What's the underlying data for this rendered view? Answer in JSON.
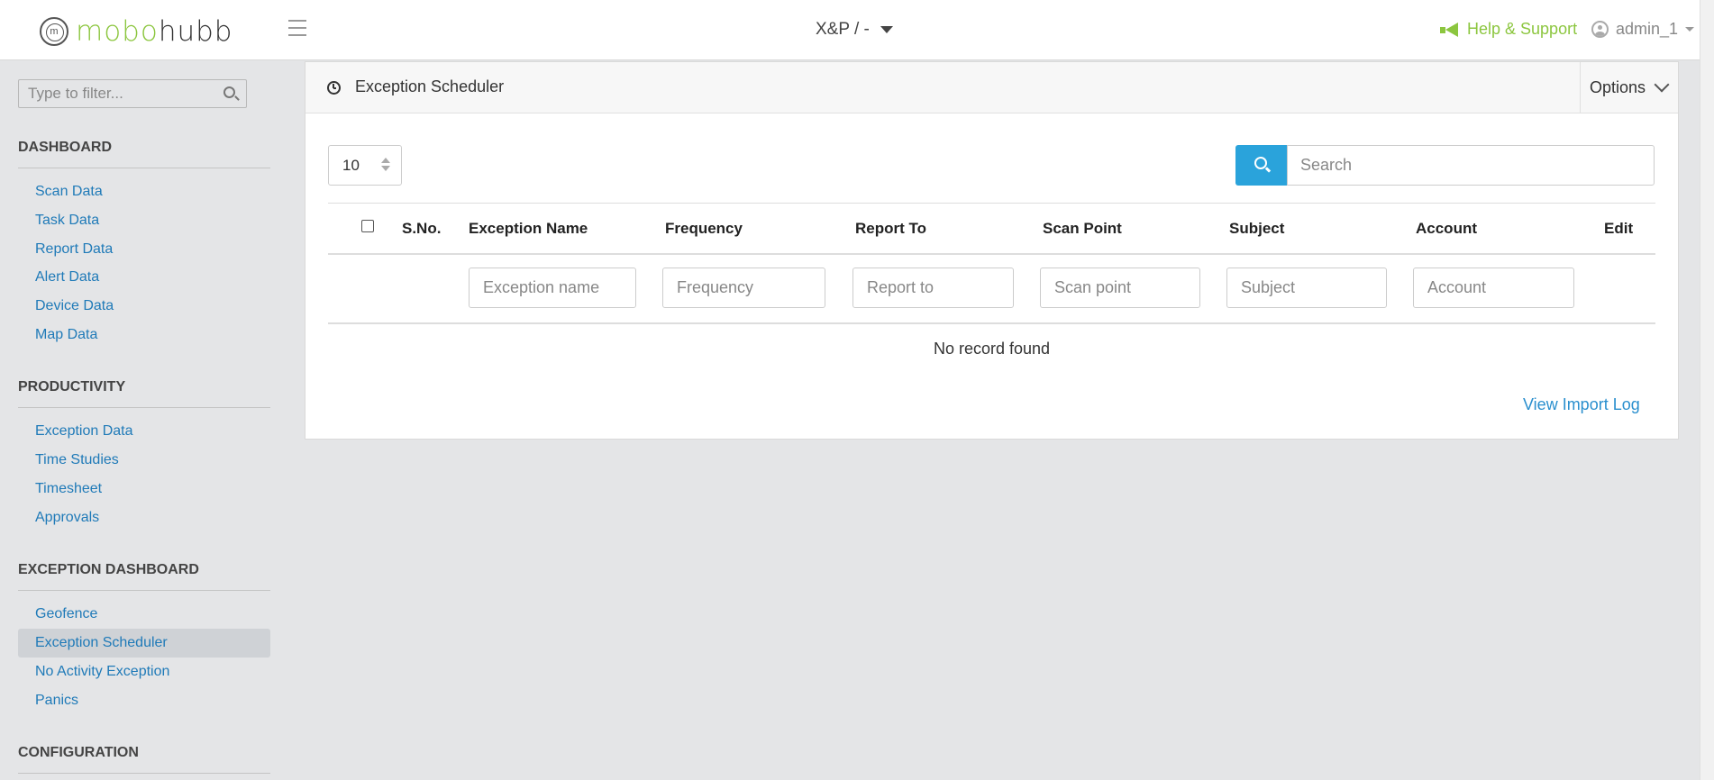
{
  "brand": {
    "logo_mark": "m",
    "name_part1": "mobo",
    "name_part2": "hubb",
    "accent": "#8cc63f"
  },
  "topbar": {
    "project": "X&P / -",
    "help": "Help & Support",
    "user": "admin_1"
  },
  "sidebar": {
    "filter_placeholder": "Type to filter...",
    "sections": [
      {
        "title": "DASHBOARD",
        "items": [
          "Scan Data",
          "Task Data",
          "Report Data",
          "Alert Data",
          "Device Data",
          "Map Data"
        ]
      },
      {
        "title": "PRODUCTIVITY",
        "items": [
          "Exception Data",
          "Time Studies",
          "Timesheet",
          "Approvals"
        ]
      },
      {
        "title": "EXCEPTION DASHBOARD",
        "items": [
          "Geofence",
          "Exception Scheduler",
          "No Activity Exception",
          "Panics"
        ]
      },
      {
        "title": "CONFIGURATION",
        "items": []
      }
    ],
    "active_item": "Exception Scheduler"
  },
  "panel": {
    "title": "Exception Scheduler",
    "options_label": "Options",
    "page_size": "10",
    "search_placeholder": "Search",
    "columns": [
      "S.No.",
      "Exception Name",
      "Frequency",
      "Report To",
      "Scan Point",
      "Subject",
      "Account",
      "Edit"
    ],
    "filters": {
      "exception_name": "Exception name",
      "frequency": "Frequency",
      "report_to": "Report to",
      "scan_point": "Scan point",
      "subject": "Subject",
      "account": "Account"
    },
    "empty_message": "No record found",
    "import_log_label": "View Import Log"
  }
}
